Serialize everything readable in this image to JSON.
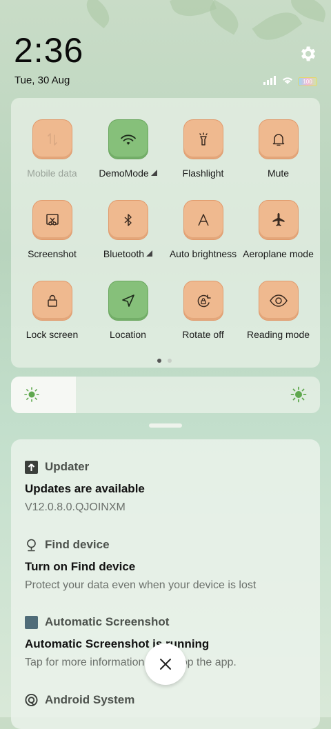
{
  "status": {
    "time": "2:36",
    "date": "Tue, 30 Aug",
    "battery": "100"
  },
  "quick_settings": {
    "tiles": [
      {
        "label": "Mobile data",
        "icon": "mobile-data-icon",
        "state": "disabled"
      },
      {
        "label": "DemoMode",
        "icon": "wifi-icon",
        "state": "on",
        "expand": true
      },
      {
        "label": "Flashlight",
        "icon": "flashlight-icon",
        "state": "off"
      },
      {
        "label": "Mute",
        "icon": "bell-icon",
        "state": "off"
      },
      {
        "label": "Screenshot",
        "icon": "screenshot-icon",
        "state": "off"
      },
      {
        "label": "Bluetooth",
        "icon": "bluetooth-icon",
        "state": "off",
        "expand": true
      },
      {
        "label": "Auto brightness",
        "icon": "auto-brightness-icon",
        "state": "off"
      },
      {
        "label": "Aeroplane mode",
        "icon": "airplane-icon",
        "state": "off"
      },
      {
        "label": "Lock screen",
        "icon": "lock-icon",
        "state": "off"
      },
      {
        "label": "Location",
        "icon": "location-icon",
        "state": "on"
      },
      {
        "label": "Rotate off",
        "icon": "rotate-icon",
        "state": "off"
      },
      {
        "label": "Reading mode",
        "icon": "eye-icon",
        "state": "off"
      }
    ],
    "page": 1,
    "pages": 2
  },
  "brightness": {
    "level": 0.21
  },
  "notifications": [
    {
      "app": "Updater",
      "icon": "updater-icon",
      "title": "Updates are available",
      "body": "V12.0.8.0.QJOINXM"
    },
    {
      "app": "Find device",
      "icon": "find-device-icon",
      "title": "Turn on Find device",
      "body": "Protect your data even when your device is lost"
    },
    {
      "app": "Automatic Screenshot",
      "icon": "automatic-screenshot-icon",
      "title": "Automatic Screenshot is running",
      "body": "Tap for more information or to stop the app."
    },
    {
      "app": "Android System",
      "icon": "android-system-icon",
      "title": "",
      "body": ""
    }
  ],
  "colors": {
    "tile_off": "#efb98f",
    "tile_on": "#86c07a",
    "background": "#c3dfcc"
  }
}
